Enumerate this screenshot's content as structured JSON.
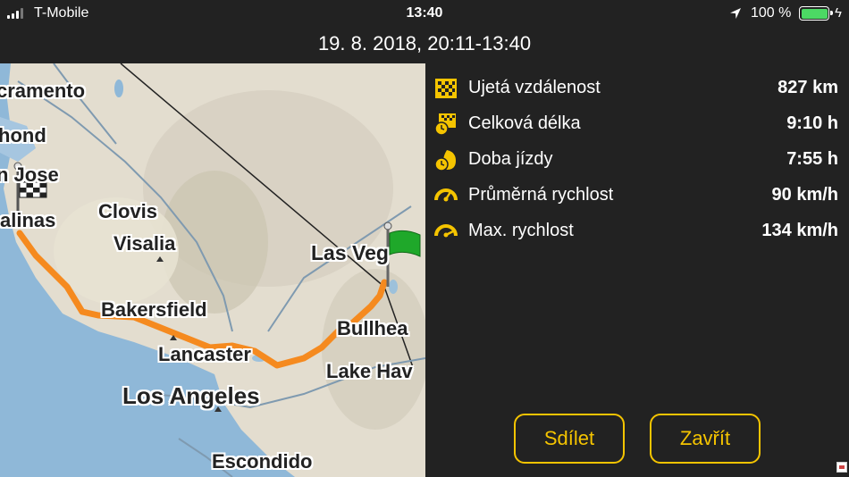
{
  "status_bar": {
    "carrier": "T-Mobile",
    "time": "13:40",
    "battery_percent": "100 %",
    "battery_level": 1.0,
    "battery_color": "#4cd964",
    "icons": [
      "signal-icon",
      "location-arrow-icon",
      "battery-icon",
      "charging-bolt-icon"
    ]
  },
  "header": {
    "title": "19. 8. 2018, 20:11-13:40"
  },
  "map": {
    "labels": {
      "sacramento": "cramento",
      "richmond": "hond",
      "san_jose": "n Jose",
      "salinas": "alinas",
      "clovis": "Clovis",
      "visalia": "Visalia",
      "las_vegas": "Las Veg",
      "bakersfield": "Bakersfield",
      "bullhead": "Bullhea",
      "lancaster": "Lancaster",
      "lake_havasu": "Lake Hav",
      "los_angeles": "Los Angeles",
      "escondido": "Escondido"
    },
    "route_color": "#f58a1f",
    "start_flag_icon": "checkered-flag-icon",
    "end_flag_icon": "green-flag-icon"
  },
  "stats": [
    {
      "icon": "checkered-distance-icon",
      "label": "Ujetá vzdálenost",
      "value": "827 km"
    },
    {
      "icon": "checkered-clock-icon",
      "label": "Celková délka",
      "value": "9:10 h"
    },
    {
      "icon": "driving-time-icon",
      "label": "Doba jízdy",
      "value": "7:55 h"
    },
    {
      "icon": "speedometer-icon",
      "label": "Průměrná rychlost",
      "value": "90 km/h"
    },
    {
      "icon": "speedometer-max-icon",
      "label": "Max. rychlost",
      "value": "134 km/h"
    }
  ],
  "buttons": {
    "share": "Sdílet",
    "close": "Zavřít"
  },
  "accent_color": "#f5c400"
}
